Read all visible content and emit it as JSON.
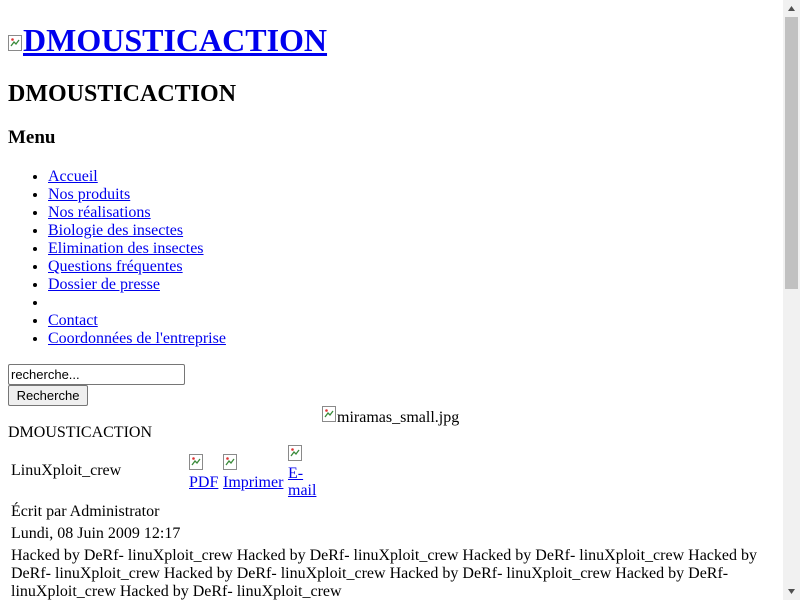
{
  "header": {
    "logo_alt": "DMOUSTICACTION",
    "site_title": "DMOUSTICACTION"
  },
  "menu": {
    "heading": "Menu",
    "items": [
      {
        "label": "Accueil"
      },
      {
        "label": "Nos produits"
      },
      {
        "label": "Nos réalisations"
      },
      {
        "label": "Biologie des insectes"
      },
      {
        "label": "Elimination des insectes"
      },
      {
        "label": "Questions fréquentes"
      },
      {
        "label": "Dossier de presse"
      },
      {
        "label": ""
      },
      {
        "label": "Contact"
      },
      {
        "label": "Coordonnées de l'entreprise"
      }
    ]
  },
  "search": {
    "value": "recherche...",
    "button_label": "Recherche"
  },
  "banner": {
    "image_alt": "miramas_small.jpg"
  },
  "article": {
    "section_title": "DMOUSTICACTION",
    "title": "LinuXploit_crew",
    "tools": {
      "pdf": "PDF",
      "print": "Imprimer",
      "email": "E-mail"
    },
    "author": "Écrit par Administrator",
    "date": "Lundi, 08 Juin 2009 12:17",
    "body": "Hacked by DeRf- linuXploit_crew Hacked by DeRf- linuXploit_crew Hacked by DeRf- linuXploit_crew Hacked by DeRf- linuXploit_crew Hacked by DeRf- linuXploit_crew Hacked by DeRf- linuXploit_crew Hacked by DeRf- linuXploit_crew Hacked by DeRf- linuXploit_crew"
  },
  "icons": {
    "broken_image": "broken-image-icon"
  }
}
